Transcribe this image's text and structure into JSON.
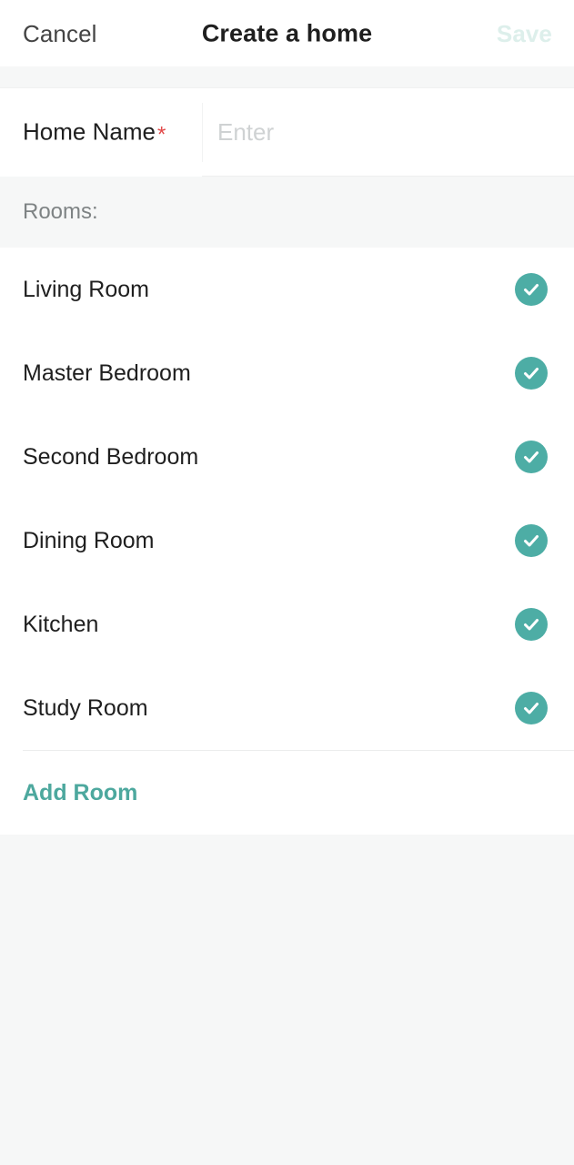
{
  "header": {
    "cancel_label": "Cancel",
    "title": "Create a home",
    "save_label": "Save",
    "save_enabled": false
  },
  "form": {
    "home_name": {
      "label": "Home Name",
      "required_marker": "*",
      "value": "",
      "placeholder": "Enter"
    }
  },
  "rooms_section": {
    "header": "Rooms:",
    "items": [
      {
        "name": "Living Room",
        "selected": true,
        "icon": "check-circle-icon"
      },
      {
        "name": "Master Bedroom",
        "selected": true,
        "icon": "check-circle-icon"
      },
      {
        "name": "Second Bedroom",
        "selected": true,
        "icon": "check-circle-icon"
      },
      {
        "name": "Dining Room",
        "selected": true,
        "icon": "check-circle-icon"
      },
      {
        "name": "Kitchen",
        "selected": true,
        "icon": "check-circle-icon"
      },
      {
        "name": "Study Room",
        "selected": true,
        "icon": "check-circle-icon"
      }
    ],
    "add_room_label": "Add Room"
  },
  "colors": {
    "accent_teal": "#4da89e",
    "check_badge": "#4dada5",
    "save_disabled": "#ddefeb",
    "required_red": "#e24a4a",
    "page_background": "#f6f7f7",
    "card_background": "#ffffff",
    "primary_text": "#1f1f1f",
    "secondary_text": "#7e8384",
    "placeholder_text": "#cfd2d3"
  }
}
